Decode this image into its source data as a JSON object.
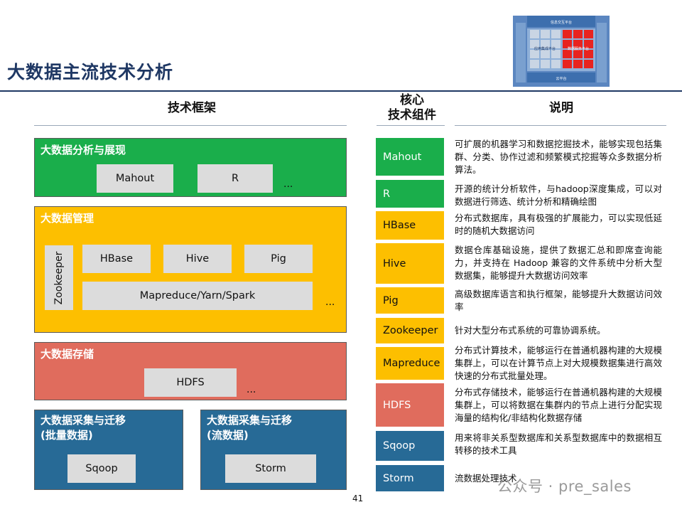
{
  "title": "大数据主流技术分析",
  "logo": {
    "top_label": "信息交互平台",
    "left_label": "应用集成平台",
    "right_label": "数据服务平台",
    "bottom_label": "云平台"
  },
  "headings": {
    "framework": "技术框架",
    "core_line1": "核心",
    "core_line2": "技术组件",
    "description": "说明"
  },
  "framework": {
    "analysis": {
      "title": "大数据分析与展现",
      "items": [
        "Mahout",
        "R"
      ],
      "more": "..."
    },
    "management": {
      "title": "大数据管理",
      "side": "Zookeeper",
      "items": [
        "HBase",
        "Hive",
        "Pig"
      ],
      "wide": "Mapreduce/Yarn/Spark",
      "more": "..."
    },
    "storage": {
      "title": "大数据存储",
      "items": [
        "HDFS"
      ],
      "more": "..."
    },
    "batch": {
      "title_line1": "大数据采集与迁移",
      "title_line2": "(批量数据)",
      "items": [
        "Sqoop"
      ]
    },
    "stream": {
      "title_line1": "大数据采集与迁移",
      "title_line2": "(流数据)",
      "items": [
        "Storm"
      ]
    }
  },
  "components": [
    {
      "name": "Mahout",
      "desc": "可扩展的机器学习和数据挖掘技术，能够实现包括集群、分类、协作过滤和频繁模式挖掘等众多数据分析算法。"
    },
    {
      "name": "R",
      "desc": "开源的统计分析软件，与hadoop深度集成，可以对数据进行筛选、统计分析和精确绘图"
    },
    {
      "name": "HBase",
      "desc": "分布式数据库，具有极强的扩展能力，可以实现低延时的随机大数据访问"
    },
    {
      "name": "Hive",
      "desc": "数据仓库基础设施，提供了数据汇总和即席查询能力，并支持在 Hadoop 兼容的文件系统中分析大型数据集，能够提升大数据访问效率"
    },
    {
      "name": "Pig",
      "desc": "高级数据库语言和执行框架，能够提升大数据访问效率"
    },
    {
      "name": "Zookeeper",
      "desc": "针对大型分布式系统的可靠协调系统。"
    },
    {
      "name": "Mapreduce",
      "desc": "分布式计算技术，能够运行在普通机器构建的大规模集群上，可以在计算节点上对大规模数据集进行高效快速的分布式批量处理。"
    },
    {
      "name": "HDFS",
      "desc": "分布式存储技术，能够运行在普通机器构建的大规模集群上，可以将数据在集群内的节点上进行分配实现海量的结构化/非结构化数据存储"
    },
    {
      "name": "Sqoop",
      "desc": "用来将非关系型数据库和关系型数据库中的数据相互转移的技术工具"
    },
    {
      "name": "Storm",
      "desc": "流数据处理技术"
    }
  ],
  "page_number": "41",
  "watermark": "公众号 · pre_sales",
  "colors": {
    "green": "#1aae4b",
    "yellow": "#fdbf00",
    "red": "#e06c5d",
    "blue": "#276a96",
    "title": "#1f3864"
  }
}
